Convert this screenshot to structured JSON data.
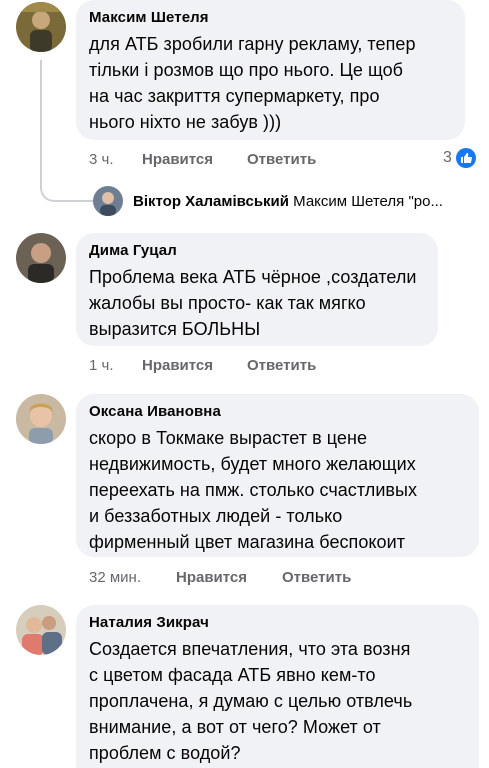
{
  "comments": [
    {
      "author": "Максим Шетеля",
      "lines": [
        "для АТБ зробили гарну рекламу, тепер",
        "тільки і розмов що про нього. Це щоб",
        "на час закриття супермаркету, про",
        "нього ніхто не забув )))"
      ],
      "time": "3 ч.",
      "like_label": "Нравится",
      "reply_label": "Ответить",
      "reaction_count": "3",
      "reaction_icon": "like-icon"
    },
    {
      "author": "Дима Гуцал",
      "lines": [
        "Проблема века АТБ чёрное ,создатели",
        "жалобы вы просто- как так мягко",
        "выразится БОЛЬНЫ"
      ],
      "time": "1 ч.",
      "like_label": "Нравится",
      "reply_label": "Ответить"
    },
    {
      "author": "Оксана Ивановна",
      "lines": [
        "скоро в Токмаке вырастет в цене",
        "недвижимость, будет много желающих",
        "переехать на пмж. столько счастливых",
        "и беззаботных людей - только",
        "фирменный цвет магазина беспокоит"
      ],
      "time": "32 мин.",
      "like_label": "Нравится",
      "reply_label": "Ответить"
    },
    {
      "author": "Наталия Зикрач",
      "lines": [
        "Создается впечатления, что эта возня",
        "с цветом фасада АТБ явно кем-то",
        "проплачена, я думаю с целью отвлечь",
        "внимание, а вот от чего? Может от",
        "проблем с водой?"
      ]
    }
  ],
  "reply": {
    "author": "Віктор Халамівський",
    "preview": "Максим Шетеля \"ро..."
  },
  "colors": {
    "accent": "#1877f2",
    "bubble": "#f0f2f5",
    "meta": "#65676b"
  }
}
